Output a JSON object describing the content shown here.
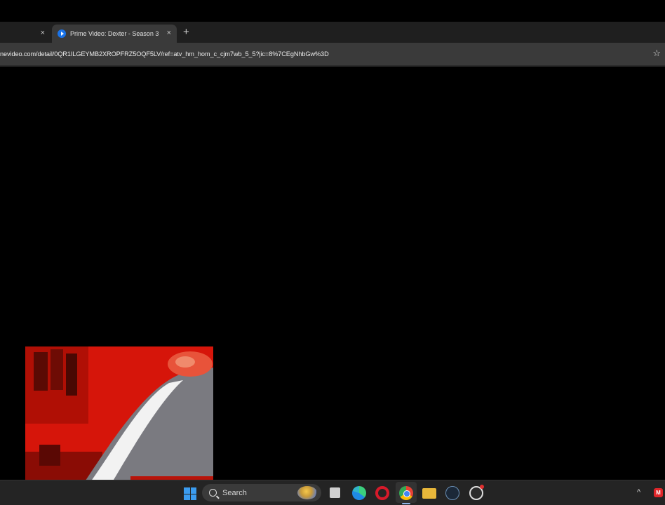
{
  "browser": {
    "tabs": [
      {
        "title": "",
        "active": false
      },
      {
        "title": "Prime Video: Dexter - Season 3",
        "active": true
      }
    ],
    "close_glyph": "×",
    "new_tab_glyph": "+",
    "url": "nevideo.com/detail/0QR1ILGEYMB2XROPFRZ5OQF5LV/ref=atv_hm_hom_c_cjm7wb_5_5?jic=8%7CEgNhbGw%3D",
    "bookmark_glyph": "☆"
  },
  "taskbar": {
    "search_label": "Search",
    "tray_chevron": "^",
    "tray_app_label": "M",
    "icons": [
      "windows-start-icon",
      "search-icon",
      "weather-icon",
      "task-view-icon",
      "edge-icon",
      "opera-icon",
      "chrome-icon",
      "file-explorer-icon",
      "steam-icon",
      "obs-icon"
    ]
  },
  "colors": {
    "background": "#000000",
    "tab_active": "#3a3a3a",
    "accent_blue": "#1a73e8",
    "webcam_red": "#d6150a"
  }
}
